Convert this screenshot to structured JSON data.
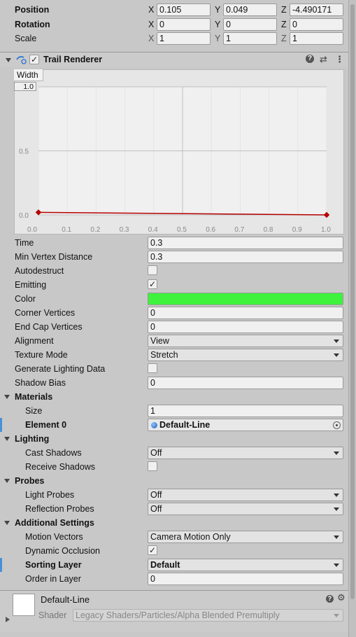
{
  "transform": {
    "position_label": "Position",
    "rotation_label": "Rotation",
    "scale_label": "Scale",
    "axis_x": "X",
    "axis_y": "Y",
    "axis_z": "Z",
    "position": {
      "x": "0.105",
      "y": "0.049",
      "z": "-4.490171"
    },
    "rotation": {
      "x": "0",
      "y": "0",
      "z": "0"
    },
    "scale": {
      "x": "1",
      "y": "1",
      "z": "1"
    }
  },
  "component": {
    "title": "Trail Renderer",
    "enabled_check": "✓",
    "help_icon": "?",
    "presets_icon": "⇄",
    "menu_icon": "⋮"
  },
  "curve": {
    "title": "Width",
    "y_max_label": "1.0",
    "chart_data": {
      "type": "line",
      "title": "Width",
      "x_ticks": [
        "0.0",
        "0.1",
        "0.2",
        "0.3",
        "0.4",
        "0.5",
        "0.6",
        "0.7",
        "0.8",
        "0.9",
        "1.0"
      ],
      "y_ticks": [
        "0.0",
        "0.5"
      ],
      "xlim": [
        0,
        1
      ],
      "ylim": [
        0,
        1
      ],
      "series": [
        {
          "x": [
            0.0,
            1.0
          ],
          "y": [
            0.02,
            0.0
          ]
        }
      ],
      "line_color": "#b40000"
    }
  },
  "props": {
    "time_label": "Time",
    "time_value": "0.3",
    "min_vertex_label": "Min Vertex Distance",
    "min_vertex_value": "0.3",
    "autodestruct_label": "Autodestruct",
    "emitting_label": "Emitting",
    "emitting_check": "✓",
    "color_label": "Color",
    "color_value": "#3ef23e",
    "corner_label": "Corner Vertices",
    "corner_value": "0",
    "endcap_label": "End Cap Vertices",
    "endcap_value": "0",
    "alignment_label": "Alignment",
    "alignment_value": "View",
    "texture_label": "Texture Mode",
    "texture_value": "Stretch",
    "lighting_data_label": "Generate Lighting Data",
    "shadow_bias_label": "Shadow Bias",
    "shadow_bias_value": "0"
  },
  "materials": {
    "title": "Materials",
    "size_label": "Size",
    "size_value": "1",
    "element_label": "Element 0",
    "element_value": "Default-Line"
  },
  "lighting": {
    "title": "Lighting",
    "cast_label": "Cast Shadows",
    "cast_value": "Off",
    "receive_label": "Receive Shadows"
  },
  "probes": {
    "title": "Probes",
    "light_label": "Light Probes",
    "light_value": "Off",
    "reflection_label": "Reflection Probes",
    "reflection_value": "Off"
  },
  "additional": {
    "title": "Additional Settings",
    "motion_label": "Motion Vectors",
    "motion_value": "Camera Motion Only",
    "dynamic_label": "Dynamic Occlusion",
    "dynamic_check": "✓",
    "sorting_label": "Sorting Layer",
    "sorting_value": "Default",
    "order_label": "Order in Layer",
    "order_value": "0"
  },
  "material_asset": {
    "name": "Default-Line",
    "shader_label": "Shader",
    "shader_value": "Legacy Shaders/Particles/Alpha Blended Premultiply",
    "help_icon": "?",
    "gear_icon": "⚙"
  }
}
